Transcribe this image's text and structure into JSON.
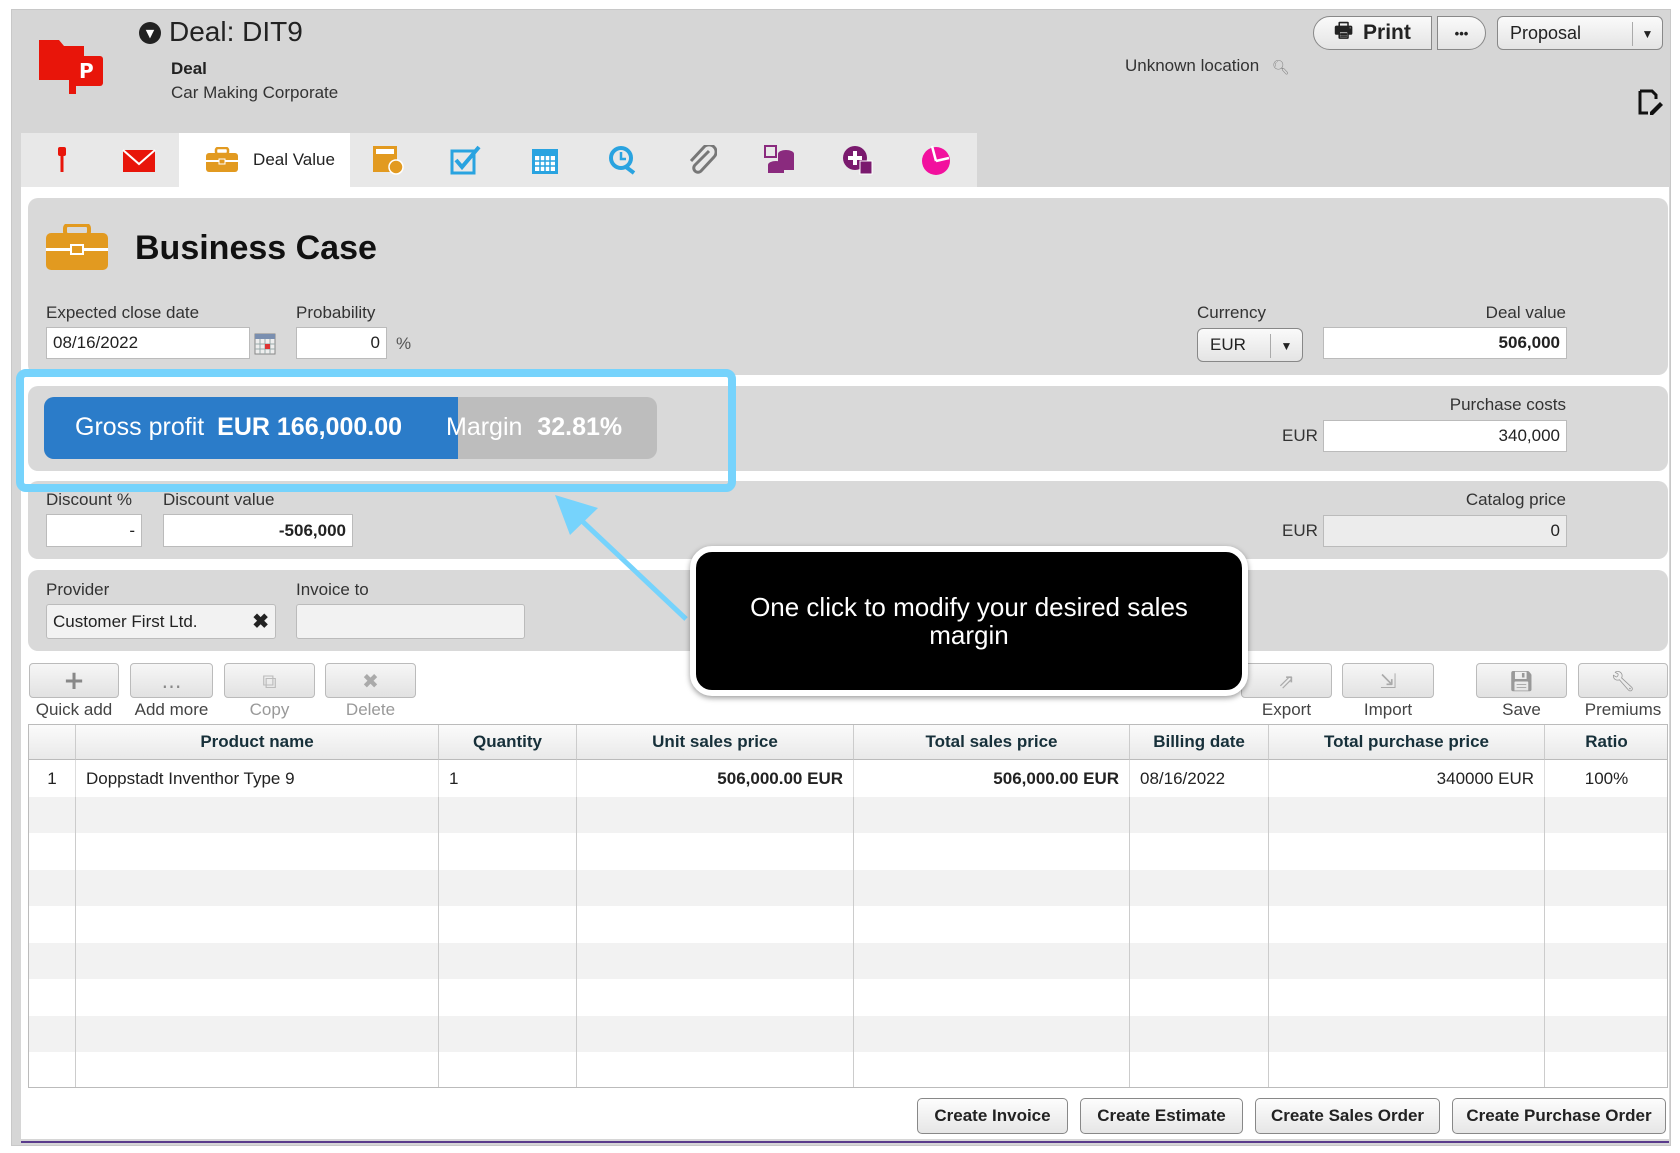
{
  "header": {
    "title": "Deal: DIT9",
    "type": "Deal",
    "company": "Car Making Corporate",
    "location": "Unknown location",
    "print_label": "Print",
    "more_label": "•••",
    "stage_select": "Proposal"
  },
  "tabs": [
    {
      "icon": "pin-icon"
    },
    {
      "icon": "mail-icon"
    },
    {
      "icon": "briefcase-icon",
      "label": "Deal Value",
      "active": true
    },
    {
      "icon": "calculator-icon"
    },
    {
      "icon": "checkbox-icon"
    },
    {
      "icon": "calendar-icon"
    },
    {
      "icon": "clock-search-icon"
    },
    {
      "icon": "paperclip-icon"
    },
    {
      "icon": "coins-icon"
    },
    {
      "icon": "add-money-icon"
    },
    {
      "icon": "pie-chart-icon"
    }
  ],
  "business_case": {
    "title": "Business Case",
    "expected_close_date_label": "Expected close date",
    "expected_close_date": "08/16/2022",
    "probability_label": "Probability",
    "probability": "0",
    "probability_unit": "%",
    "currency_label": "Currency",
    "currency": "EUR",
    "deal_value_label": "Deal value",
    "deal_value": "506,000",
    "gross_profit_label": "Gross profit",
    "gross_profit": "EUR 166,000.00",
    "margin_label": "Margin",
    "margin": "32.81%",
    "purchase_costs_label": "Purchase costs",
    "purchase_costs_currency": "EUR",
    "purchase_costs": "340,000",
    "discount_pct_label": "Discount %",
    "discount_pct": "-",
    "discount_value_label": "Discount value",
    "discount_value": "-506,000",
    "catalog_price_label": "Catalog price",
    "catalog_price_currency": "EUR",
    "catalog_price": "0",
    "provider_label": "Provider",
    "provider": "Customer First Ltd.",
    "invoice_to_label": "Invoice to",
    "invoice_to": ""
  },
  "toolbar": {
    "quick_add": "Quick add",
    "add_more": "Add more",
    "copy": "Copy",
    "delete": "Delete",
    "export": "Export",
    "import": "Import",
    "save": "Save",
    "premiums": "Premiums"
  },
  "table": {
    "columns": [
      "",
      "Product name",
      "Quantity",
      "Unit sales price",
      "Total sales price",
      "Billing date",
      "Total purchase price",
      "Ratio"
    ],
    "rows": [
      [
        "1",
        "Doppstadt Inventhor Type 9",
        "1",
        "506,000.00 EUR",
        "506,000.00 EUR",
        "08/16/2022",
        "340000 EUR",
        "100%"
      ]
    ]
  },
  "actions": {
    "create_invoice": "Create Invoice",
    "create_estimate": "Create Estimate",
    "create_sales_order": "Create Sales Order",
    "create_purchase_order": "Create Purchase Order"
  },
  "callout": {
    "text": "One click to modify your desired sales margin"
  },
  "colors": {
    "gross_profit_bar": "#2b7cc9",
    "margin_bar": "#bdbdbd",
    "highlight": "#76d3fc",
    "logo": "#e8150a"
  }
}
